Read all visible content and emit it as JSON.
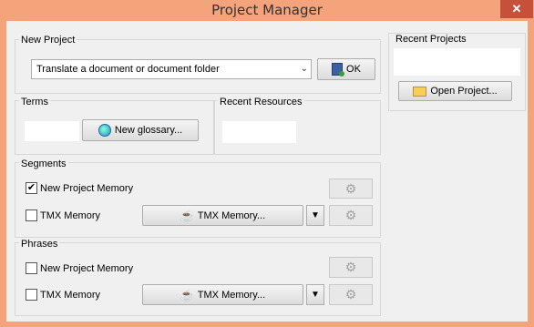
{
  "window": {
    "title": "Project Manager",
    "close_glyph": "✕"
  },
  "new_project": {
    "label": "New Project",
    "combo_value": "Translate a document or document folder",
    "ok_label": "OK"
  },
  "terms": {
    "label": "Terms",
    "new_glossary_label": "New glossary..."
  },
  "recent_resources": {
    "label": "Recent Resources"
  },
  "recent_projects": {
    "label": "Recent Projects",
    "open_project_label": "Open Project..."
  },
  "segments": {
    "label": "Segments",
    "new_project_memory": {
      "label": "New Project Memory",
      "checked": true
    },
    "tmx_memory": {
      "label": "TMX Memory",
      "checked": false,
      "button_label": "TMX Memory..."
    }
  },
  "phrases": {
    "label": "Phrases",
    "new_project_memory": {
      "label": "New Project Memory",
      "checked": false
    },
    "tmx_memory": {
      "label": "TMX Memory",
      "checked": false,
      "button_label": "TMX Memory..."
    }
  },
  "glyphs": {
    "check": "✔",
    "dropdown": "▼",
    "gear": "⚙",
    "cup": "☕"
  },
  "icons": [
    "ok-icon",
    "globe-icon",
    "folder-icon",
    "cup-icon",
    "gear-icon",
    "check-icon",
    "dropdown-icon"
  ]
}
